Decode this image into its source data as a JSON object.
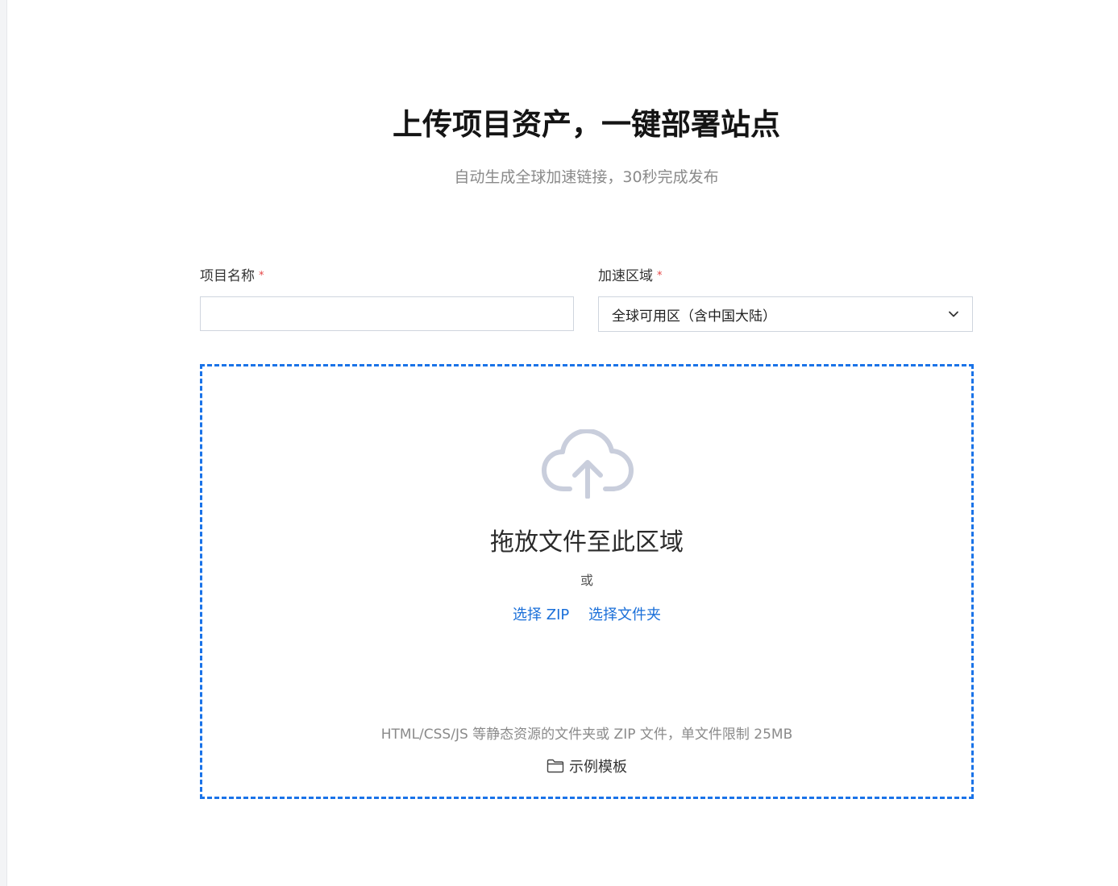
{
  "header": {
    "title": "上传项目资产，一键部署站点",
    "subtitle": "自动生成全球加速链接，30秒完成发布"
  },
  "form": {
    "project_name": {
      "label": "项目名称",
      "required_mark": "*",
      "value": "",
      "placeholder": ""
    },
    "region": {
      "label": "加速区域",
      "required_mark": "*",
      "selected": "全球可用区（含中国大陆）"
    }
  },
  "dropzone": {
    "title": "拖放文件至此区域",
    "or": "或",
    "choose_zip": "选择 ZIP",
    "choose_folder": "选择文件夹",
    "hint": "HTML/CSS/JS 等静态资源的文件夹或 ZIP 文件，单文件限制 25MB",
    "template_link": "示例模板"
  },
  "colors": {
    "accent": "#1a73e8",
    "link": "#1a6fd9",
    "required": "#e54545",
    "cloud_icon": "#c9cedc"
  },
  "icons": {
    "upload": "cloud-upload-icon",
    "select": "chevron-down-icon",
    "template": "folder-icon"
  }
}
